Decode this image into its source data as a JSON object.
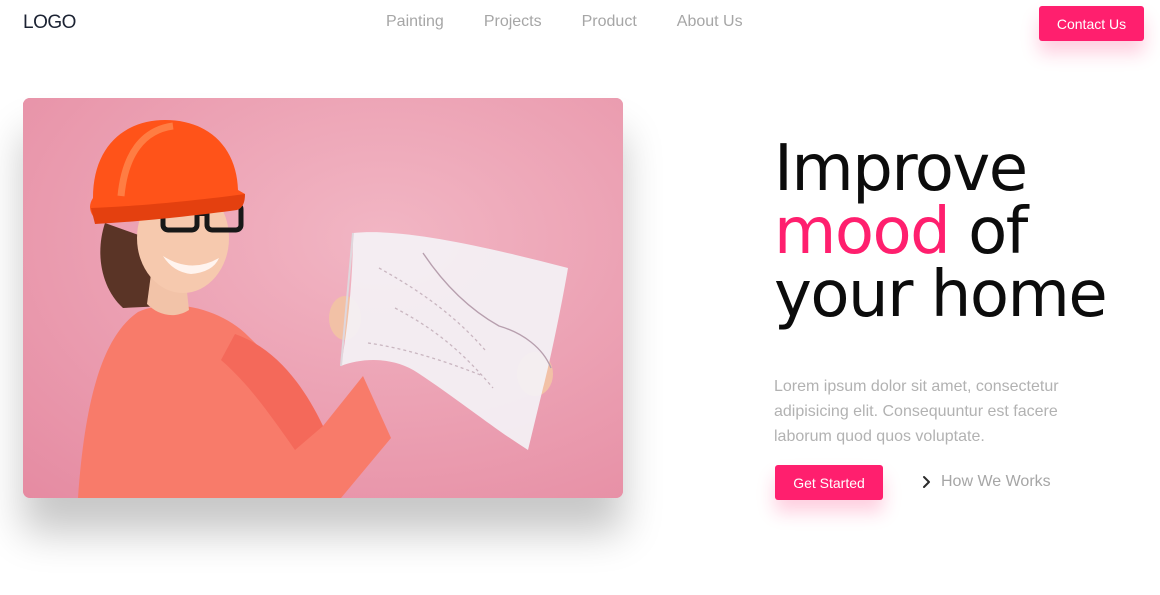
{
  "brand": {
    "logo_text": "LOGO",
    "accent_color": "#ff1f6e"
  },
  "nav": {
    "links": [
      "Painting",
      "Projects",
      "Product",
      "About Us"
    ],
    "contact_label": "Contact Us"
  },
  "hero": {
    "image_description": "woman-in-hardhat-holding-blueprint",
    "headline": {
      "line1": "Improve",
      "accent_word": "mood",
      "line2_rest": " of",
      "line3": "your home"
    },
    "lead_text": "Lorem ipsum dolor sit amet, consectetur adipisicing elit. Consequuntur est facere laborum quod quos voluptate.",
    "primary_button_label": "Get Started",
    "secondary_link_label": "How We Works",
    "secondary_link_icon": "chevron-right-icon"
  }
}
